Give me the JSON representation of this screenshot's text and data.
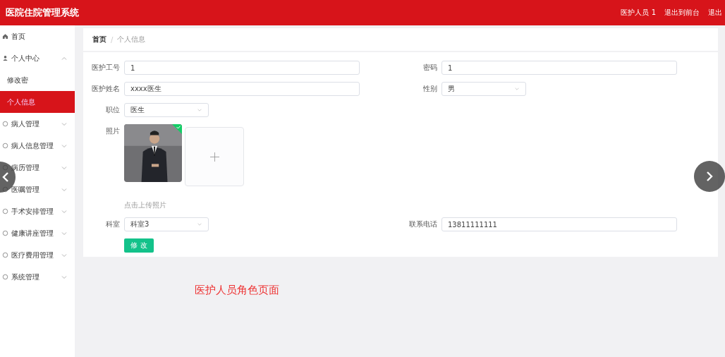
{
  "header": {
    "title": "医院住院管理系统",
    "user": "医护人员 1",
    "links": [
      "退出到前台",
      "退出"
    ]
  },
  "sidebar": {
    "items": [
      {
        "label": "首页"
      },
      {
        "label": "个人中心",
        "expandable": true,
        "expanded": true,
        "children": [
          {
            "label": "修改密",
            "selected": false
          },
          {
            "label": "个人信息",
            "selected": true
          }
        ]
      },
      {
        "label": "病人管理",
        "expandable": true,
        "expanded": false
      },
      {
        "label": "病人信息管理",
        "expandable": true,
        "expanded": false
      },
      {
        "label": "病历管理",
        "expandable": true,
        "expanded": false
      },
      {
        "label": "医嘱管理",
        "expandable": true,
        "expanded": false
      },
      {
        "label": "手术安排管理",
        "expandable": true,
        "expanded": false
      },
      {
        "label": "健康讲座管理",
        "expandable": true,
        "expanded": false
      },
      {
        "label": "医疗费用管理",
        "expandable": true,
        "expanded": false
      },
      {
        "label": "系统管理",
        "expandable": true,
        "expanded": false
      }
    ]
  },
  "breadcrumb": {
    "items": [
      "首页",
      "个人信息"
    ],
    "separator": "/"
  },
  "form": {
    "rows": [
      [
        {
          "kind": "text",
          "label": "医护工号",
          "value": "1"
        },
        {
          "kind": "text",
          "label": "密码",
          "value": "1"
        }
      ],
      [
        {
          "kind": "text",
          "label": "医护姓名",
          "value": "xxxx医生"
        },
        {
          "kind": "select",
          "label": "性别",
          "value": "男"
        }
      ],
      [
        {
          "kind": "select",
          "label": "职位",
          "value": "医生"
        }
      ],
      [
        {
          "label": "照片",
          "hint": "点击上传照片",
          "uploaded": true
        }
      ],
      [
        {
          "kind": "select",
          "label": "科室",
          "value": "科室3"
        },
        {
          "kind": "text",
          "label": "联系电话",
          "value": "13811111111"
        }
      ]
    ],
    "submit": "修 改"
  },
  "caption": "医护人员角色页面"
}
